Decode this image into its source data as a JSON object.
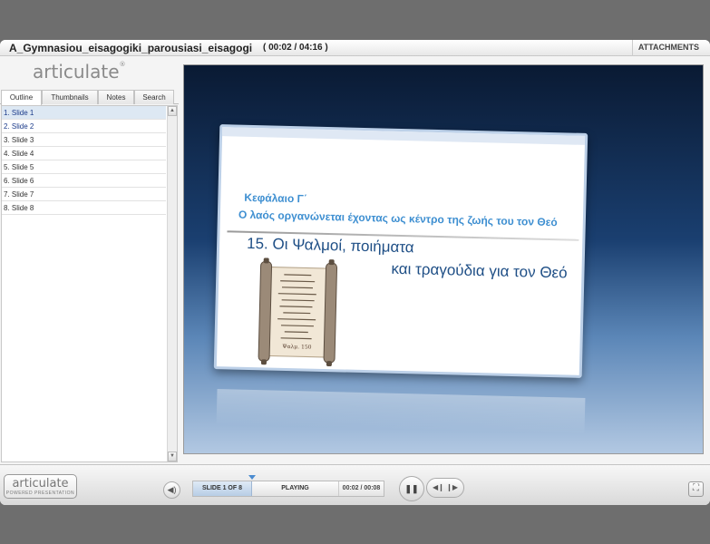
{
  "titlebar": {
    "course_title": "A_Gymnasiou_eisagogiki_parousiasi_eisagogi",
    "elapsed": "( 00:02 / 04:16 )",
    "attachments_label": "ATTACHMENTS"
  },
  "sidebar": {
    "logo_text": "articulate",
    "tabs": [
      {
        "label": "Outline",
        "active": true
      },
      {
        "label": "Thumbnails",
        "active": false
      },
      {
        "label": "Notes",
        "active": false
      },
      {
        "label": "Search",
        "active": false
      }
    ],
    "outline": [
      {
        "label": "1.  Slide 1",
        "state": "current"
      },
      {
        "label": "2.  Slide 2",
        "state": "visited"
      },
      {
        "label": "3.  Slide 3",
        "state": "default"
      },
      {
        "label": "4.  Slide 4",
        "state": "default"
      },
      {
        "label": "5.  Slide 5",
        "state": "default"
      },
      {
        "label": "6.  Slide 6",
        "state": "default"
      },
      {
        "label": "7.  Slide 7",
        "state": "default"
      },
      {
        "label": "8.  Slide 8",
        "state": "default"
      }
    ]
  },
  "slide": {
    "chapter": "Κεφάλαιο Γ΄",
    "chapter_subtitle": "Ο λαός οργανώνεται έχοντας ως κέντρο της ζωής του τον Θεό",
    "heading_line1": "15. Οι Ψαλμοί, ποιήματα",
    "heading_line2": "και τραγούδια για τον Θεό",
    "scroll_footer": "Ψαλμ. 150"
  },
  "controls": {
    "brand_name": "articulate",
    "brand_tag": "POWERED PRESENTATION",
    "slide_counter": "SLIDE 1 OF 8",
    "status": "PLAYING",
    "time": "00:02 / 00:08"
  },
  "colors": {
    "accent_blue": "#3e8fd1",
    "heading_blue": "#1f4f86",
    "current_row": "#dde8f3"
  }
}
